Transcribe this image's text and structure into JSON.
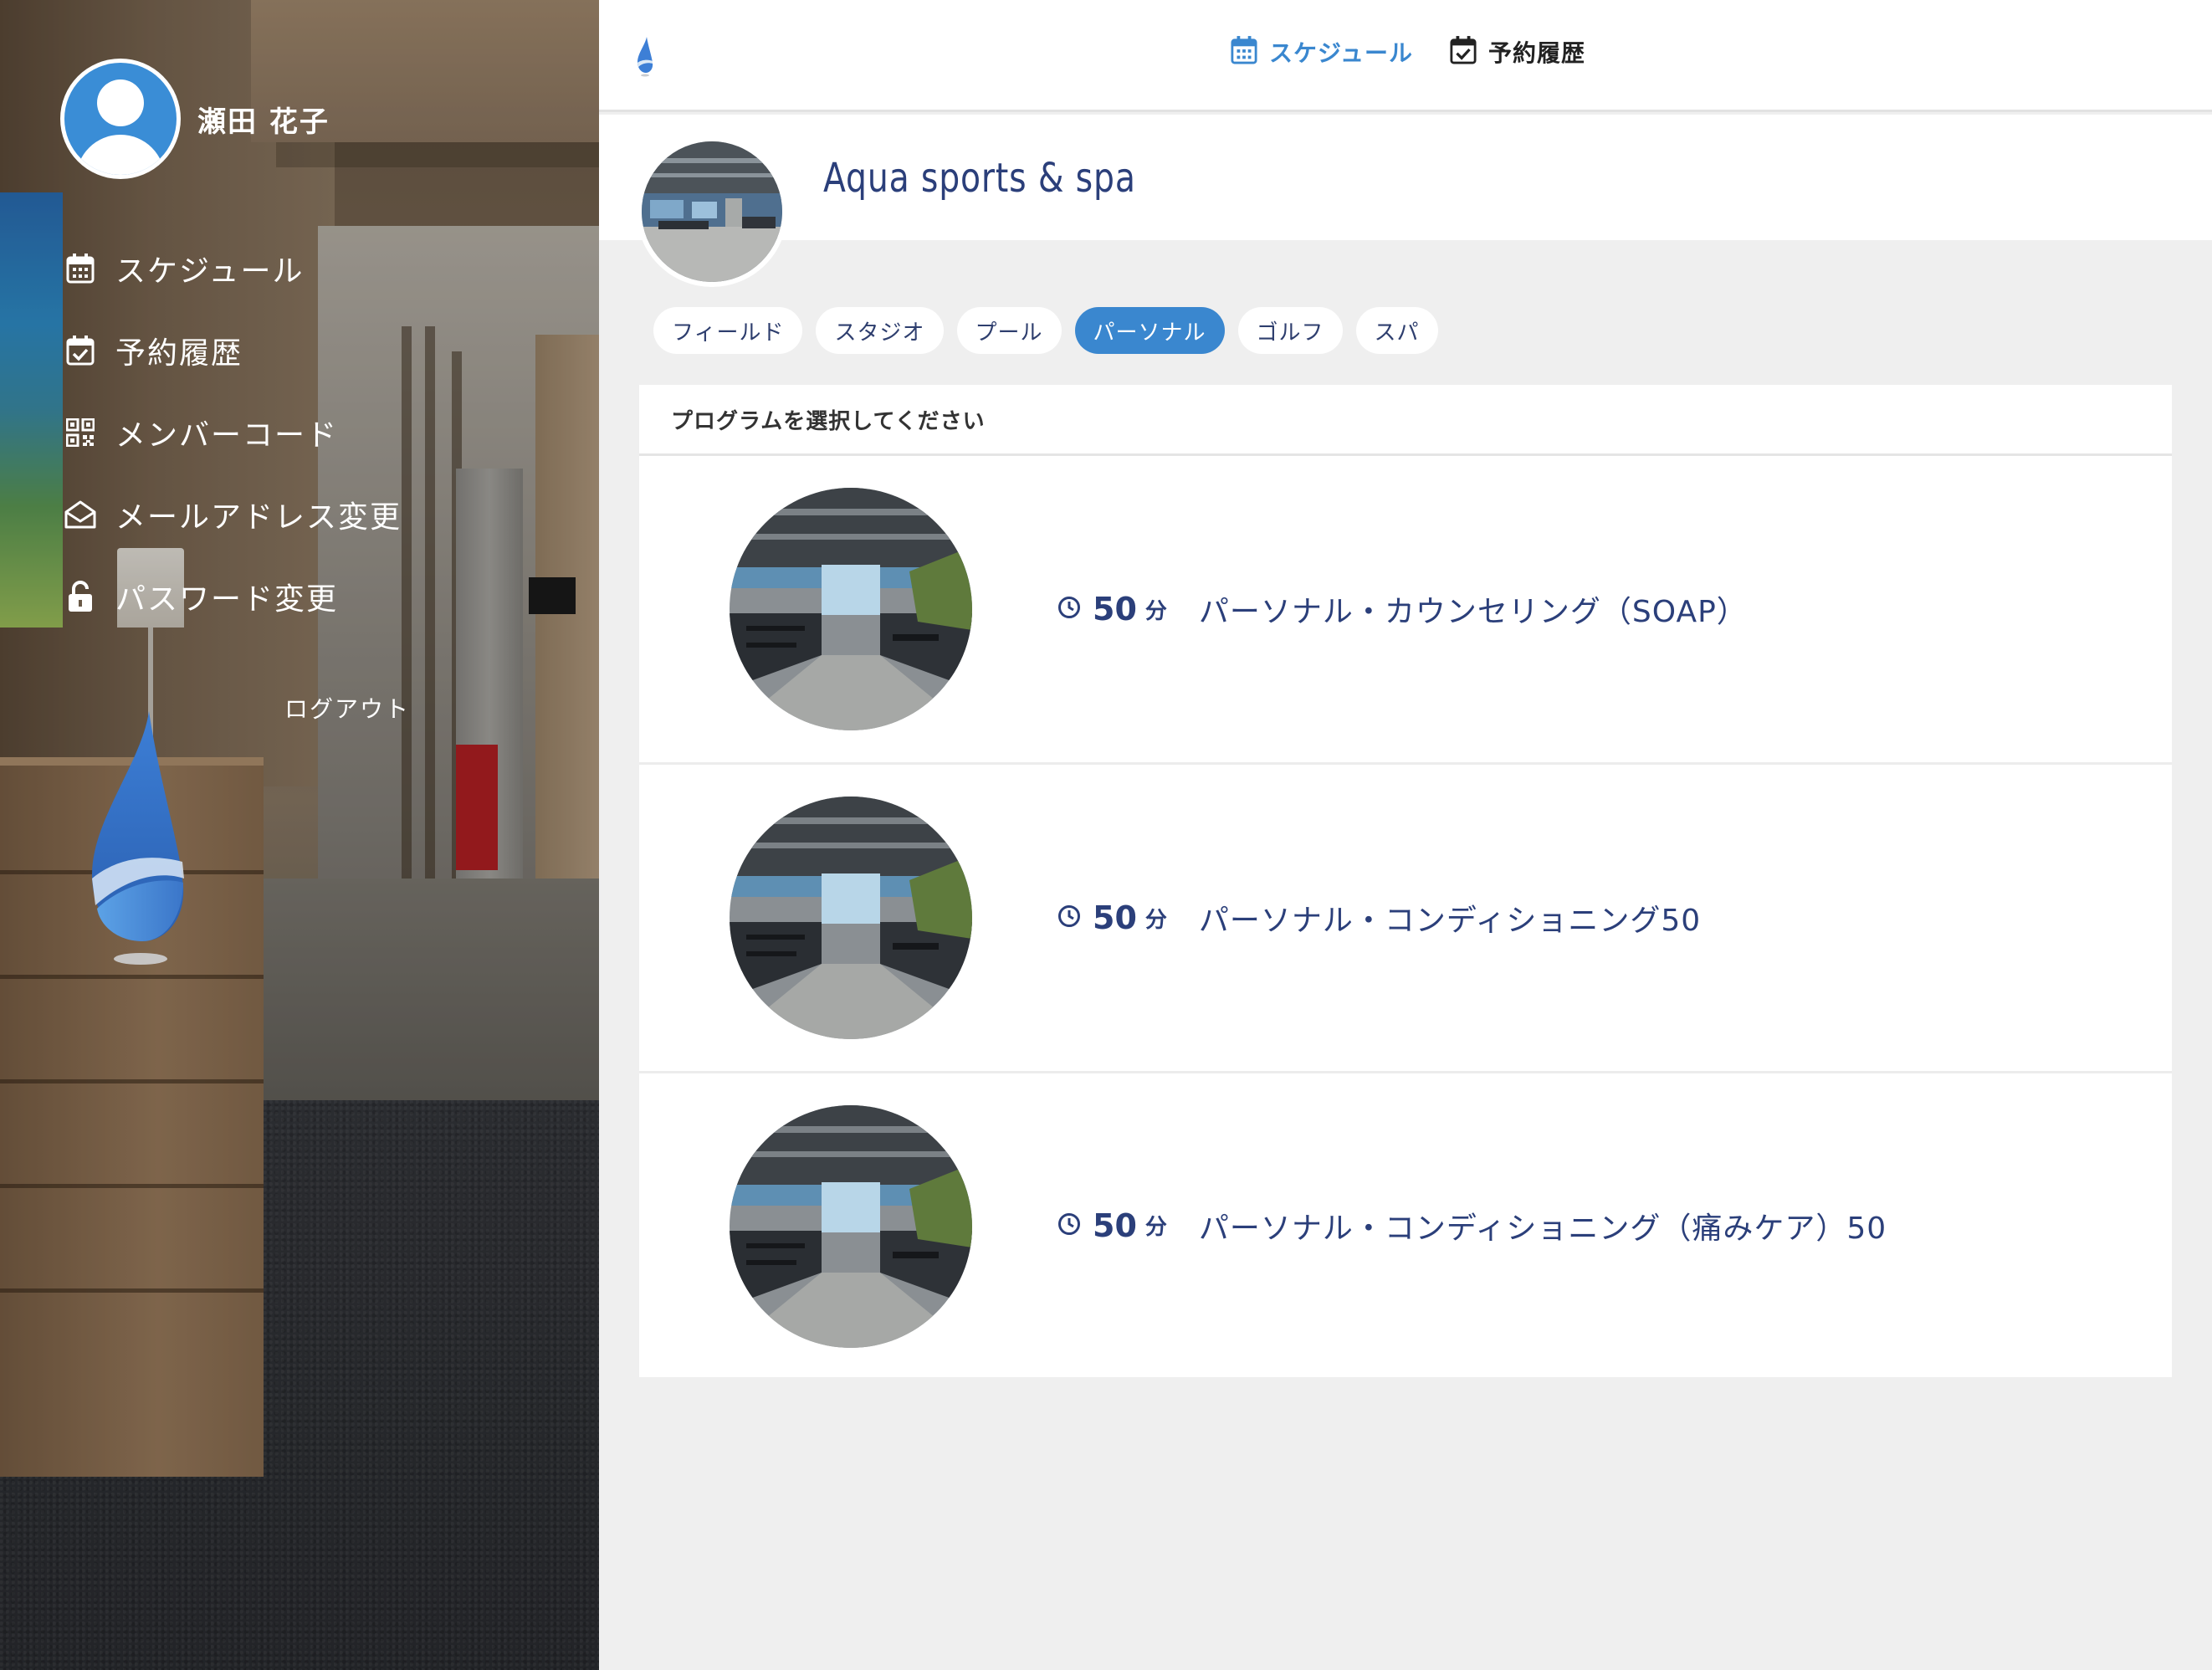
{
  "user": {
    "name": "瀬田 花子"
  },
  "sidebar": {
    "items": [
      {
        "label": "スケジュール",
        "icon": "calendar-icon"
      },
      {
        "label": "予約履歴",
        "icon": "calendar-check-icon"
      },
      {
        "label": "メンバーコード",
        "icon": "qr-code-icon"
      },
      {
        "label": "メールアドレス変更",
        "icon": "envelope-open-icon"
      },
      {
        "label": "パスワード変更",
        "icon": "unlock-icon"
      }
    ],
    "logout_label": "ログアウト"
  },
  "topnav": {
    "items": [
      {
        "label": "スケジュール",
        "icon": "calendar-icon",
        "active": true
      },
      {
        "label": "予約履歴",
        "icon": "calendar-check-icon",
        "active": false
      }
    ]
  },
  "facility": {
    "name": "Aqua sports & spa"
  },
  "categories": {
    "items": [
      "フィールド",
      "スタジオ",
      "プール",
      "パーソナル",
      "ゴルフ",
      "スパ"
    ],
    "selected": "パーソナル"
  },
  "programs": {
    "header": "プログラムを選択してください",
    "items": [
      {
        "duration": "50",
        "unit": "分",
        "name": "パーソナル・カウンセリング（SOAP）"
      },
      {
        "duration": "50",
        "unit": "分",
        "name": "パーソナル・コンディショニング50"
      },
      {
        "duration": "50",
        "unit": "分",
        "name": "パーソナル・コンディショニング（痛みケア）50"
      }
    ]
  },
  "colors": {
    "accent": "#3a87cf",
    "text_navy": "#2b3f7a",
    "avatar": "#3a8dd6"
  }
}
